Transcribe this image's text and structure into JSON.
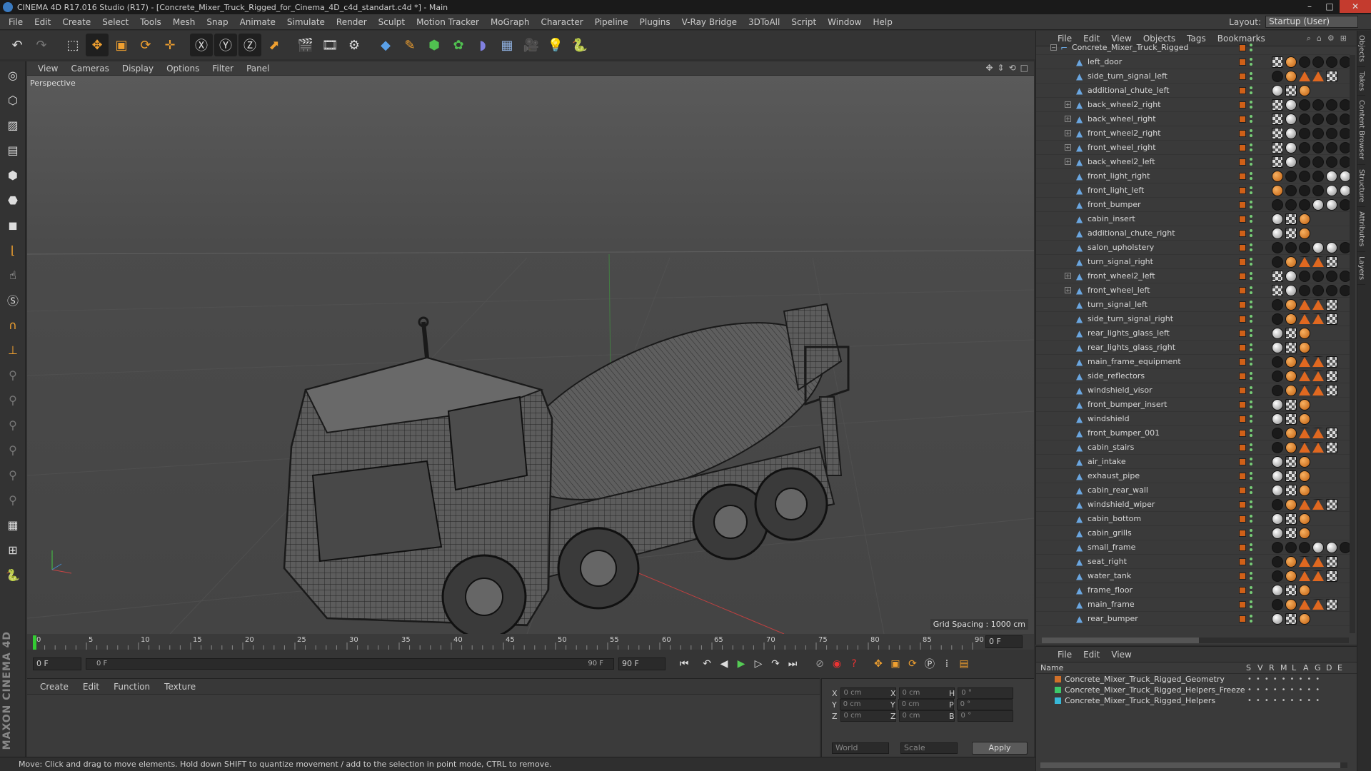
{
  "app": {
    "title": "CINEMA 4D R17.016 Studio (R17) - [Concrete_Mixer_Truck_Rigged_for_Cinema_4D_c4d_standart.c4d *] - Main"
  },
  "menu": [
    "File",
    "Edit",
    "Create",
    "Select",
    "Tools",
    "Mesh",
    "Snap",
    "Animate",
    "Simulate",
    "Render",
    "Sculpt",
    "Motion Tracker",
    "MoGraph",
    "Character",
    "Pipeline",
    "Plugins",
    "V-Ray Bridge",
    "3DToAll",
    "Script",
    "Window",
    "Help"
  ],
  "layout": {
    "label": "Layout:",
    "value": "Startup (User)"
  },
  "viewport": {
    "menu": [
      "View",
      "Cameras",
      "Display",
      "Options",
      "Filter",
      "Panel"
    ],
    "camera": "Perspective",
    "grid_spacing": "Grid Spacing : 1000 cm"
  },
  "timeline": {
    "ticks": [
      "0",
      "5",
      "10",
      "15",
      "20",
      "25",
      "30",
      "35",
      "40",
      "45",
      "50",
      "55",
      "60",
      "65",
      "70",
      "75",
      "80",
      "85",
      "90"
    ],
    "end_field": "0 F",
    "current_frame": "0 F",
    "slider_start": "0 F",
    "slider_end": "90 F",
    "max_frame": "90 F"
  },
  "material_manager": {
    "menu": [
      "Create",
      "Edit",
      "Function",
      "Texture"
    ]
  },
  "coords": {
    "rows": [
      {
        "a": "X",
        "av": "0 cm",
        "b": "X",
        "bv": "0 cm",
        "c": "H",
        "cv": "0 °"
      },
      {
        "a": "Y",
        "av": "0 cm",
        "b": "Y",
        "bv": "0 cm",
        "c": "P",
        "cv": "0 °"
      },
      {
        "a": "Z",
        "av": "0 cm",
        "b": "Z",
        "bv": "0 cm",
        "c": "B",
        "cv": "0 °"
      }
    ],
    "mode1": "World",
    "mode2": "Scale",
    "apply": "Apply"
  },
  "status": "Move: Click and drag to move elements. Hold down SHIFT to quantize movement / add to the selection in point mode, CTRL to remove.",
  "object_manager": {
    "menu": [
      "File",
      "Edit",
      "View",
      "Objects",
      "Tags",
      "Bookmarks"
    ],
    "root": "Concrete_Mixer_Truck_Rigged",
    "objects": [
      {
        "name": "left_door",
        "exp": false,
        "tags": "t1"
      },
      {
        "name": "side_turn_signal_left",
        "exp": false,
        "tags": "t2"
      },
      {
        "name": "additional_chute_left",
        "exp": false,
        "tags": "t3"
      },
      {
        "name": "back_wheel2_right",
        "exp": true,
        "tags": "t4"
      },
      {
        "name": "back_wheel_right",
        "exp": true,
        "tags": "t4"
      },
      {
        "name": "front_wheel2_right",
        "exp": true,
        "tags": "t4"
      },
      {
        "name": "front_wheel_right",
        "exp": true,
        "tags": "t4"
      },
      {
        "name": "back_wheel2_left",
        "exp": true,
        "tags": "t4"
      },
      {
        "name": "front_light_right",
        "exp": false,
        "tags": "t5"
      },
      {
        "name": "front_light_left",
        "exp": false,
        "tags": "t5"
      },
      {
        "name": "front_bumper",
        "exp": false,
        "tags": "t6"
      },
      {
        "name": "cabin_insert",
        "exp": false,
        "tags": "t3"
      },
      {
        "name": "additional_chute_right",
        "exp": false,
        "tags": "t3"
      },
      {
        "name": "salon_upholstery",
        "exp": false,
        "tags": "t6"
      },
      {
        "name": "turn_signal_right",
        "exp": false,
        "tags": "t2"
      },
      {
        "name": "front_wheel2_left",
        "exp": true,
        "tags": "t4"
      },
      {
        "name": "front_wheel_left",
        "exp": true,
        "tags": "t4"
      },
      {
        "name": "turn_signal_left",
        "exp": false,
        "tags": "t2"
      },
      {
        "name": "side_turn_signal_right",
        "exp": false,
        "tags": "t2"
      },
      {
        "name": "rear_lights_glass_left",
        "exp": false,
        "tags": "t3"
      },
      {
        "name": "rear_lights_glass_right",
        "exp": false,
        "tags": "t3"
      },
      {
        "name": "main_frame_equipment",
        "exp": false,
        "tags": "t2"
      },
      {
        "name": "side_reflectors",
        "exp": false,
        "tags": "t2"
      },
      {
        "name": "windshield_visor",
        "exp": false,
        "tags": "t2"
      },
      {
        "name": "front_bumper_insert",
        "exp": false,
        "tags": "t3"
      },
      {
        "name": "windshield",
        "exp": false,
        "tags": "t3"
      },
      {
        "name": "front_bumper_001",
        "exp": false,
        "tags": "t2"
      },
      {
        "name": "cabin_stairs",
        "exp": false,
        "tags": "t2"
      },
      {
        "name": "air_intake",
        "exp": false,
        "tags": "t3"
      },
      {
        "name": "exhaust_pipe",
        "exp": false,
        "tags": "t3"
      },
      {
        "name": "cabin_rear_wall",
        "exp": false,
        "tags": "t3"
      },
      {
        "name": "windshield_wiper",
        "exp": false,
        "tags": "t2"
      },
      {
        "name": "cabin_bottom",
        "exp": false,
        "tags": "t3"
      },
      {
        "name": "cabin_grills",
        "exp": false,
        "tags": "t3"
      },
      {
        "name": "small_frame",
        "exp": false,
        "tags": "t6"
      },
      {
        "name": "seat_right",
        "exp": false,
        "tags": "t2"
      },
      {
        "name": "water_tank",
        "exp": false,
        "tags": "t2"
      },
      {
        "name": "frame_floor",
        "exp": false,
        "tags": "t3"
      },
      {
        "name": "main_frame",
        "exp": false,
        "tags": "t2"
      },
      {
        "name": "rear_bumper",
        "exp": false,
        "tags": "t3"
      }
    ]
  },
  "layer_manager": {
    "menu": [
      "File",
      "Edit",
      "View"
    ],
    "header": {
      "name": "Name",
      "cols": [
        "S",
        "V",
        "R",
        "M",
        "L",
        "A",
        "G",
        "D",
        "E"
      ]
    },
    "layers": [
      {
        "name": "Concrete_Mixer_Truck_Rigged_Geometry",
        "color": "#d0702a"
      },
      {
        "name": "Concrete_Mixer_Truck_Rigged_Helpers_Freeze",
        "color": "#3cc86a"
      },
      {
        "name": "Concrete_Mixer_Truck_Rigged_Helpers",
        "color": "#38b8d8"
      }
    ]
  },
  "right_tabs": [
    "Objects",
    "Takes",
    "Content Browser",
    "Structure",
    "Attributes",
    "Layers"
  ],
  "brand": "MAXON CINEMA 4D"
}
